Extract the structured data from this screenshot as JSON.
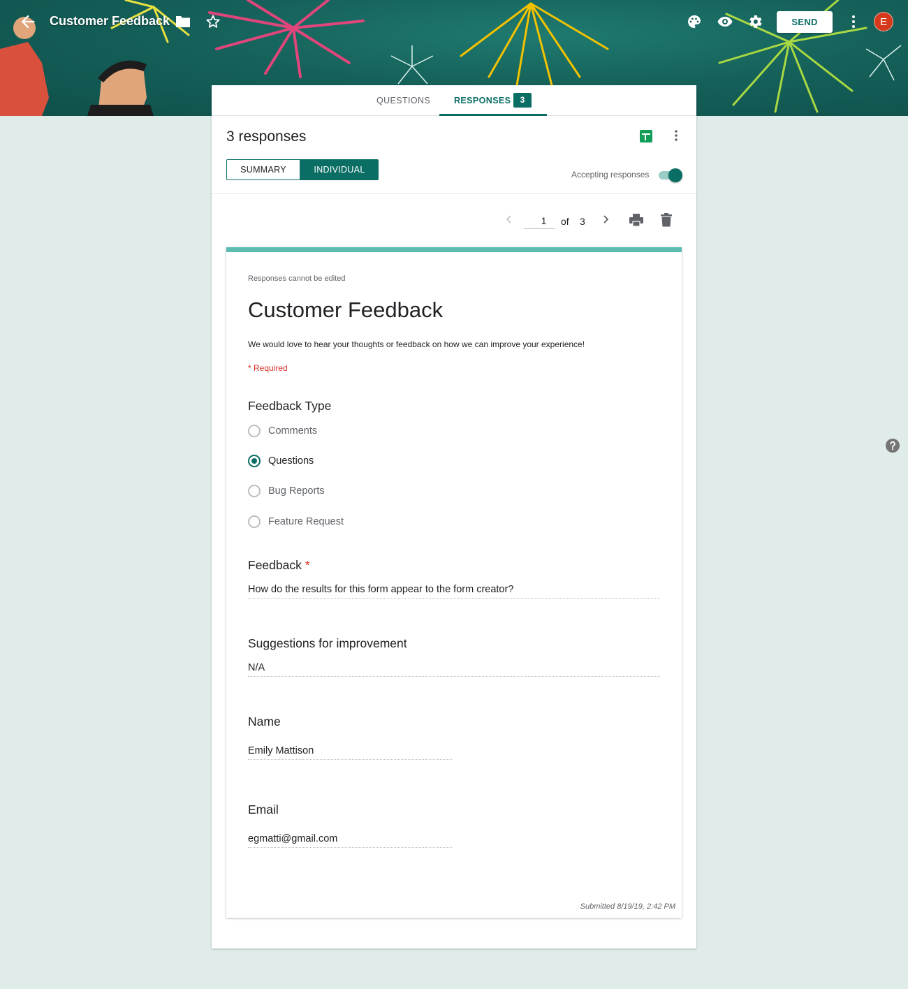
{
  "header": {
    "form_title": "Customer Feedback",
    "icons": [
      "back-arrow-icon",
      "folder-icon",
      "star-icon",
      "palette-icon",
      "eye-icon",
      "gear-icon",
      "more-vert-icon"
    ],
    "send_label": "SEND",
    "avatar_initial": "E",
    "avatar_color": "#d5391c",
    "theme_color": "#0b6e65"
  },
  "tabs": {
    "questions_label": "QUESTIONS",
    "responses_label": "RESPONSES",
    "responses_count": "3",
    "active": "responses"
  },
  "responses_panel": {
    "title": "3 responses",
    "summary_label": "SUMMARY",
    "individual_label": "INDIVIDUAL",
    "active_view": "individual",
    "accepting_label": "Accepting responses",
    "accepting_on": true,
    "pager": {
      "current": "1",
      "of_label": "of",
      "total": "3"
    }
  },
  "response": {
    "cannot_edit_note": "Responses cannot be edited",
    "title": "Customer Feedback",
    "description": "We would love to hear your thoughts or feedback on how we can improve your experience!",
    "required_note": "* Required",
    "questions": {
      "feedback_type": {
        "title": "Feedback Type",
        "options": [
          "Comments",
          "Questions",
          "Bug Reports",
          "Feature Request"
        ],
        "selected": "Questions"
      },
      "feedback": {
        "title": "Feedback",
        "required_mark": "*",
        "answer": "How do the results for this form appear to the form creator?"
      },
      "suggestions": {
        "title": "Suggestions for improvement",
        "answer": "N/A"
      },
      "name": {
        "title": "Name",
        "answer": "Emily Mattison"
      },
      "email": {
        "title": "Email",
        "answer": "egmatti@gmail.com"
      }
    },
    "submitted": "Submitted 8/19/19, 2:42 PM"
  }
}
